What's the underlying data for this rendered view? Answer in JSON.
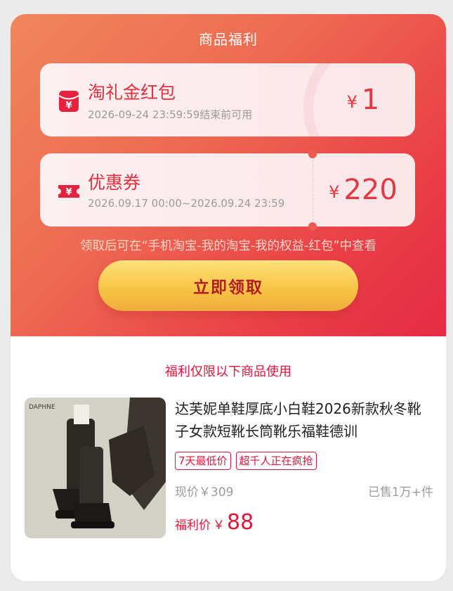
{
  "header": {
    "title": "商品福利"
  },
  "coupons": [
    {
      "title": "淘礼金红包",
      "subtitle": "2026-09-24 23:59:59结束前可用",
      "currency": "¥",
      "amount": "1",
      "icon": "red-envelope-icon"
    },
    {
      "title": "优惠券",
      "subtitle": "2026.09.17 00:00~2026.09.24 23:59",
      "currency": "¥",
      "amount": "220",
      "icon": "ticket-icon"
    }
  ],
  "tip": "领取后可在“手机淘宝-我的淘宝-我的权益-红包”中查看",
  "claim_button": "立即领取",
  "limit_text": "福利仅限以下商品使用",
  "product": {
    "name": "达芙妮单鞋厚底小白鞋2026新款秋冬靴子女款短靴长筒靴乐福鞋德训",
    "brand_text": "DAPHNE",
    "tags": [
      "7天最低价",
      "超千人正在疯抢"
    ],
    "current_price": "现价￥309",
    "sold": "已售1万+件",
    "deal_label": "福利价",
    "deal_currency": "￥",
    "deal_price": "88"
  },
  "colors": {
    "accent": "#e0163b",
    "header_gradient_start": "#f0865c",
    "header_gradient_end": "#e52b45",
    "button_gold": "#f7c243",
    "button_text": "#b01d24"
  }
}
